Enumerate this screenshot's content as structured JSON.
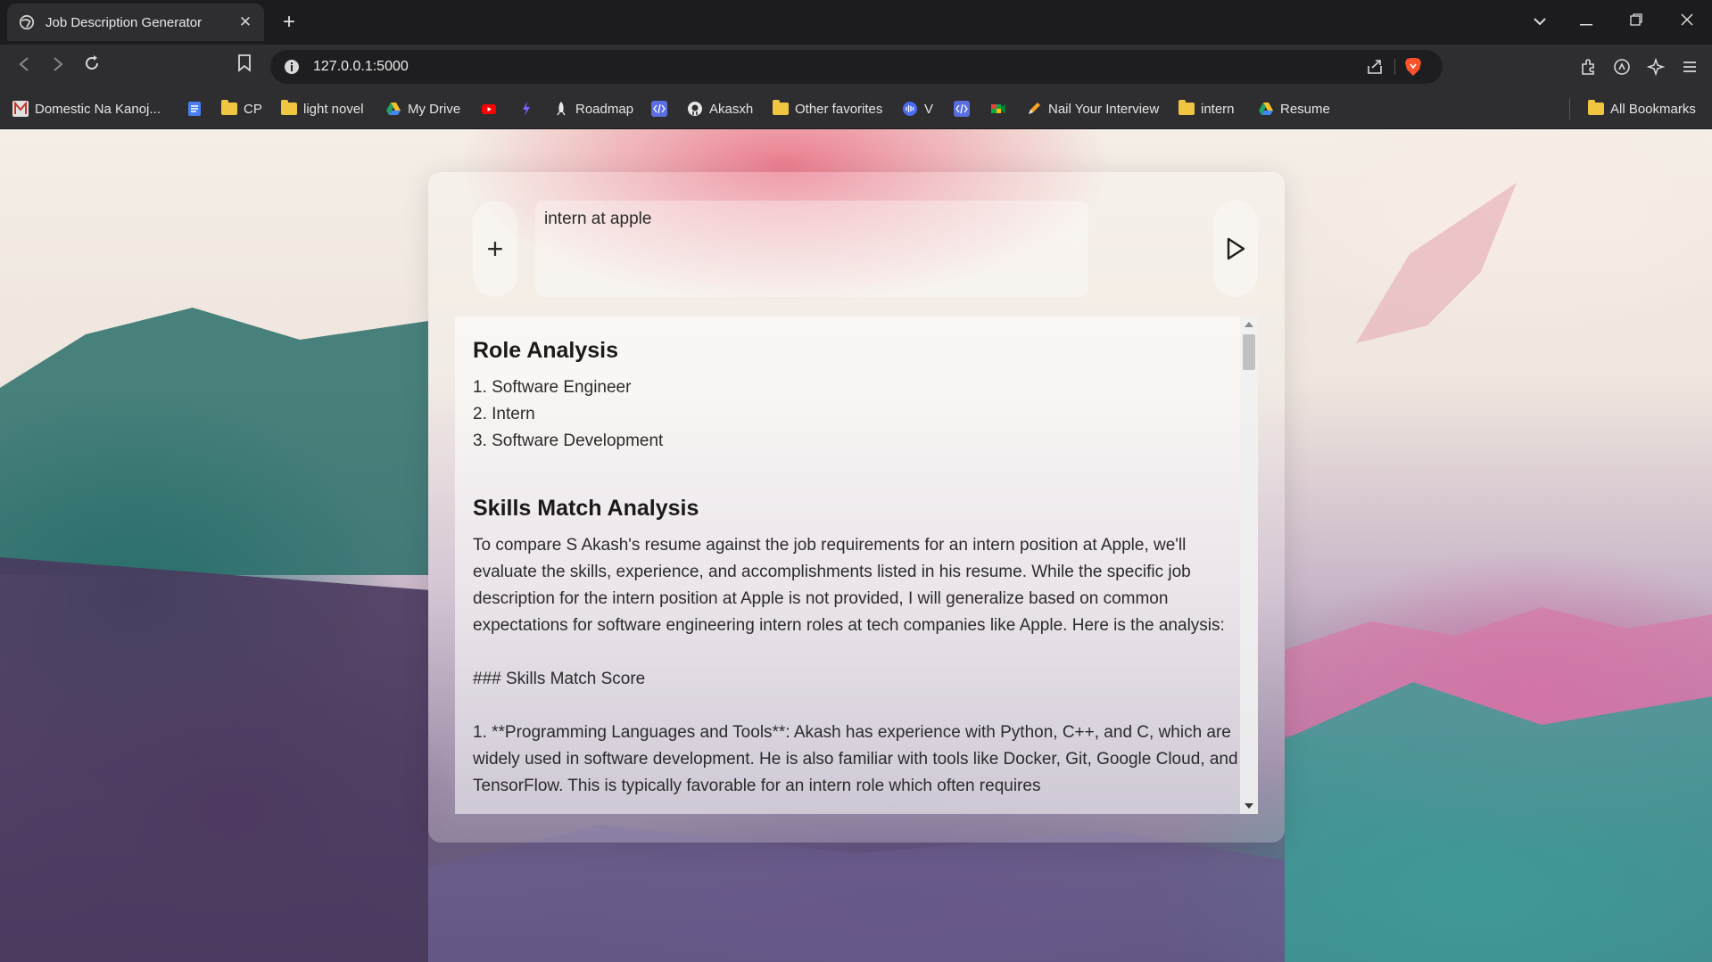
{
  "browser": {
    "tab_title": "Job Description Generator",
    "tab_close": "✕",
    "new_tab": "+",
    "url": "127.0.0.1:5000",
    "window_controls": {
      "dropdown": "⌄",
      "minimize": "—",
      "restore": "❐",
      "close": "✕"
    },
    "bookmarks": [
      {
        "label": "Domestic Na Kanoj...",
        "icon": "manga-icon"
      },
      {
        "label": "",
        "icon": "docs-icon"
      },
      {
        "label": "CP",
        "icon": "folder-icon"
      },
      {
        "label": "light novel",
        "icon": "folder-icon"
      },
      {
        "label": "My Drive",
        "icon": "drive-icon"
      },
      {
        "label": "",
        "icon": "youtube-icon"
      },
      {
        "label": "",
        "icon": "bolt-icon"
      },
      {
        "label": "Roadmap",
        "icon": "rocket-icon"
      },
      {
        "label": "",
        "icon": "code-icon"
      },
      {
        "label": "Akasxh",
        "icon": "github-icon"
      },
      {
        "label": "Other favorites",
        "icon": "folder-icon"
      },
      {
        "label": "V",
        "icon": "voice-icon"
      },
      {
        "label": "",
        "icon": "code-icon"
      },
      {
        "label": "",
        "icon": "meet-icon"
      },
      {
        "label": "Nail Your Interview",
        "icon": "pen-icon"
      },
      {
        "label": "intern",
        "icon": "folder-icon"
      },
      {
        "label": "Resume",
        "icon": "drive-icon"
      }
    ],
    "all_bookmarks": "All Bookmarks"
  },
  "app": {
    "prompt_value": "intern at apple",
    "plus_label": "+",
    "result": {
      "section1_title": "Role Analysis",
      "roles": [
        "1. Software Engineer",
        "2. Intern",
        "3. Software Development"
      ],
      "section2_title": "Skills Match Analysis",
      "paragraph1": "To compare S Akash's resume against the job requirements for an intern position at Apple, we'll evaluate the skills, experience, and accomplishments listed in his resume. While the specific job description for the intern position at Apple is not provided, I will generalize based on common expectations for software engineering intern roles at tech companies like Apple. Here is the analysis:",
      "subheading": "### Skills Match Score",
      "paragraph2": "1. **Programming Languages and Tools**: Akash has experience with Python, C++, and C, which are widely used in software development. He is also familiar with tools like Docker, Git, Google Cloud, and TensorFlow. This is typically favorable for an intern role which often requires"
    }
  },
  "colors": {
    "accent_pink": "#e9889b",
    "teal": "#2e7d7b"
  }
}
